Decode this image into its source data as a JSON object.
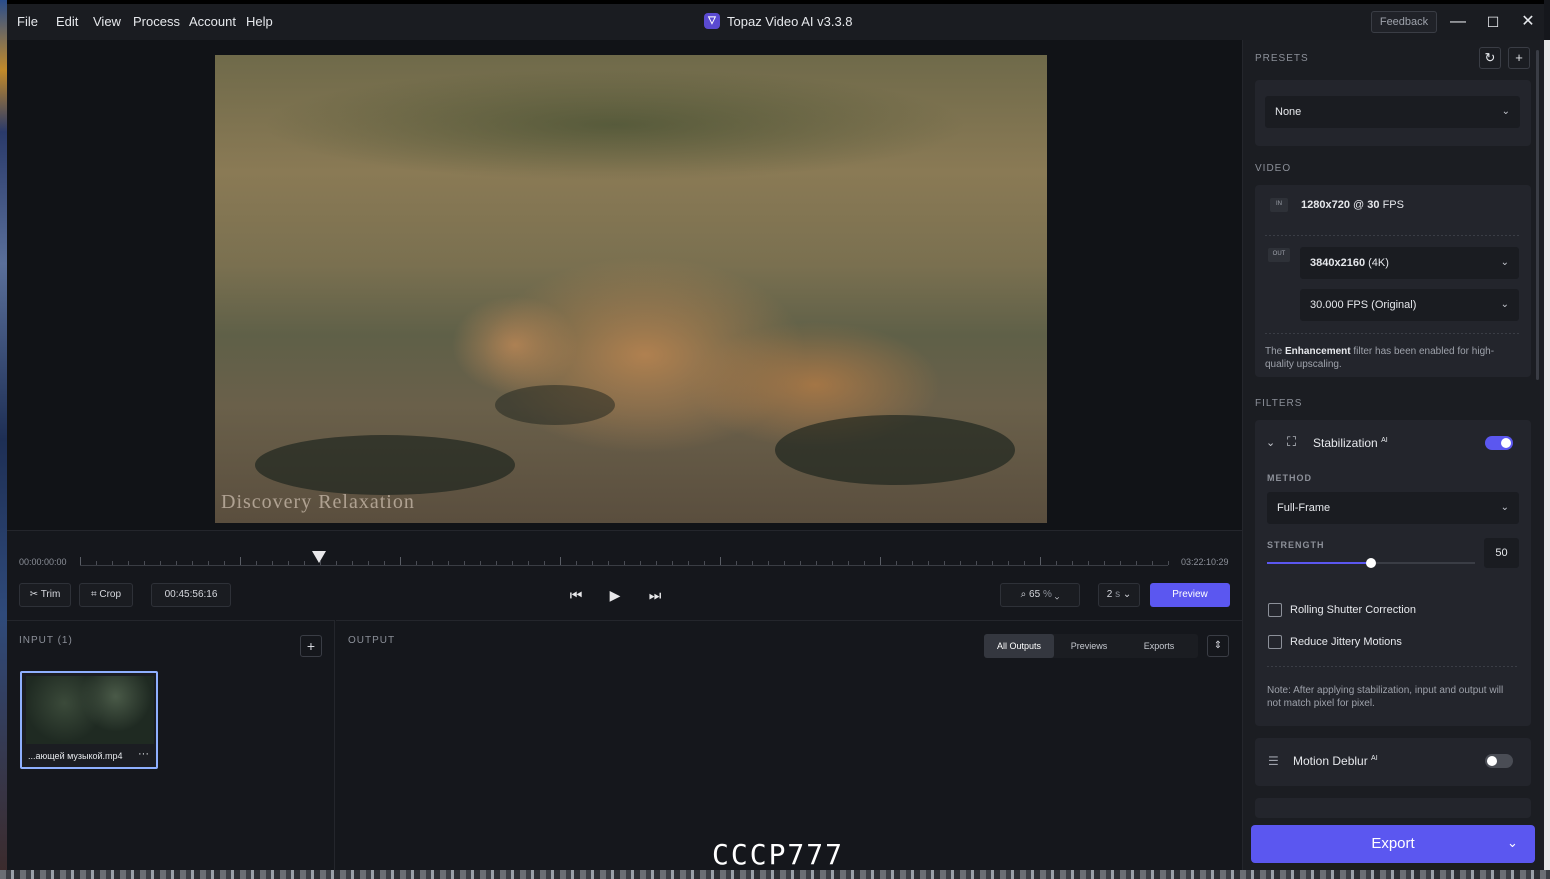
{
  "menu": [
    "File",
    "Edit",
    "View",
    "Process",
    "Account",
    "Help"
  ],
  "app_title": "Topaz Video AI  v3.3.8",
  "feedback_label": "Feedback",
  "video": {
    "watermark": "Discovery Relaxation"
  },
  "timeline": {
    "start": "00:00:00:00",
    "end": "03:22:10:29",
    "playhead_fraction": 0.22,
    "trim_label": "Trim",
    "crop_label": "Crop",
    "current_time": "00:45:56:16",
    "zoom": "65",
    "zoom_unit": "%",
    "preview_duration": "2",
    "preview_duration_unit": "s",
    "preview_label": "Preview"
  },
  "input_panel": {
    "title": "INPUT (1)",
    "file_name": "...ающей музыкой.mp4",
    "more": "···"
  },
  "output_panel": {
    "title": "OUTPUT",
    "tabs": [
      "All Outputs",
      "Previews",
      "Exports"
    ],
    "active_tab": "All Outputs",
    "overlay_text": "CCCP777"
  },
  "sidebar": {
    "presets_title": "PRESETS",
    "preset_value": "None",
    "video_title": "VIDEO",
    "in_badge": "IN",
    "out_badge": "OUT",
    "in_res": "1280x720",
    "in_at": "@",
    "in_fps": "30",
    "in_fps_unit": "FPS",
    "out_res": "3840x2160",
    "out_res_note": "(4K)",
    "out_fps": "30.000 FPS (Original)",
    "enh_pre": "The",
    "enh_bold": "Enhancement",
    "enh_post": "filter has been enabled for high-quality upscaling.",
    "filters_title": "FILTERS",
    "stab_name": "Stabilization",
    "ai_sup": "AI",
    "stab_enabled": true,
    "method_label": "METHOD",
    "method_value": "Full-Frame",
    "strength_label": "STRENGTH",
    "strength_value": "50",
    "strength_fraction": 0.5,
    "rolling_shutter": "Rolling Shutter Correction",
    "reduce_jitter": "Reduce Jittery Motions",
    "note": "Note: After applying stabilization, input and output will not match pixel for pixel.",
    "deblur_name": "Motion Deblur",
    "deblur_enabled": false,
    "export_label": "Export"
  },
  "colors": {
    "accent": "#5b57f0",
    "panel": "#1b1d22",
    "bg": "#15171c"
  }
}
